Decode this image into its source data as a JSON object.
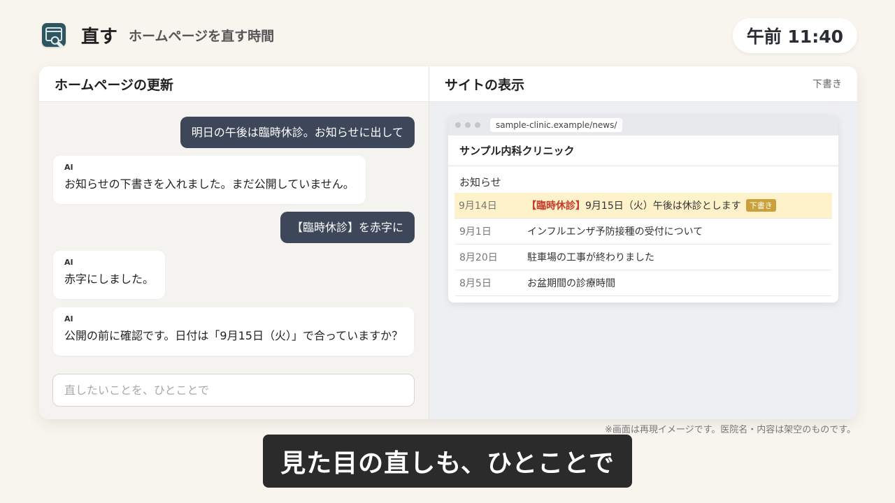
{
  "header": {
    "app_icon": "browser-wrench-icon",
    "title": "直す",
    "subtitle": "ホームページを直す時間",
    "clock": "午前 11:40"
  },
  "chat_panel": {
    "title": "ホームページの更新",
    "messages": [
      {
        "role": "user",
        "text": "明日の午後は臨時休診。お知らせに出して"
      },
      {
        "role": "ai",
        "sender": "AI",
        "text": "お知らせの下書きを入れました。まだ公開していません。"
      },
      {
        "role": "user",
        "text": "【臨時休診】を赤字に"
      },
      {
        "role": "ai",
        "sender": "AI",
        "text": "赤字にしました。"
      },
      {
        "role": "ai",
        "sender": "AI",
        "text": "公開の前に確認です。日付は「9月15日（火）」で合っていますか？"
      }
    ],
    "input_placeholder": "直したいことを、ひとことで"
  },
  "preview_panel": {
    "title": "サイトの表示",
    "status": "下書き",
    "browser": {
      "url": "sample-clinic.example/news/",
      "site_name": "サンプル内科クリニック",
      "section_title": "お知らせ",
      "news": [
        {
          "date": "9月14日",
          "tag": "【臨時休診】",
          "title": "9月15日（火）午後は休診とします",
          "badge": "下書き",
          "highlight": true
        },
        {
          "date": "9月1日",
          "title": "インフルエンザ予防接種の受付について"
        },
        {
          "date": "8月20日",
          "title": "駐車場の工事が終わりました"
        },
        {
          "date": "8月5日",
          "title": "お盆期間の診療時間"
        }
      ]
    }
  },
  "disclaimer": "※画面は再現イメージです。医院名・内容は架空のものです。",
  "caption": "見た目の直しも、ひとことで",
  "colors": {
    "background": "#f8f4ee",
    "user_bubble": "#3d4759",
    "highlight_row": "#fdf2c9",
    "red_tag": "#c53a2b",
    "draft_badge": "#c9a03a",
    "caption_bg": "#2b2b2b"
  }
}
